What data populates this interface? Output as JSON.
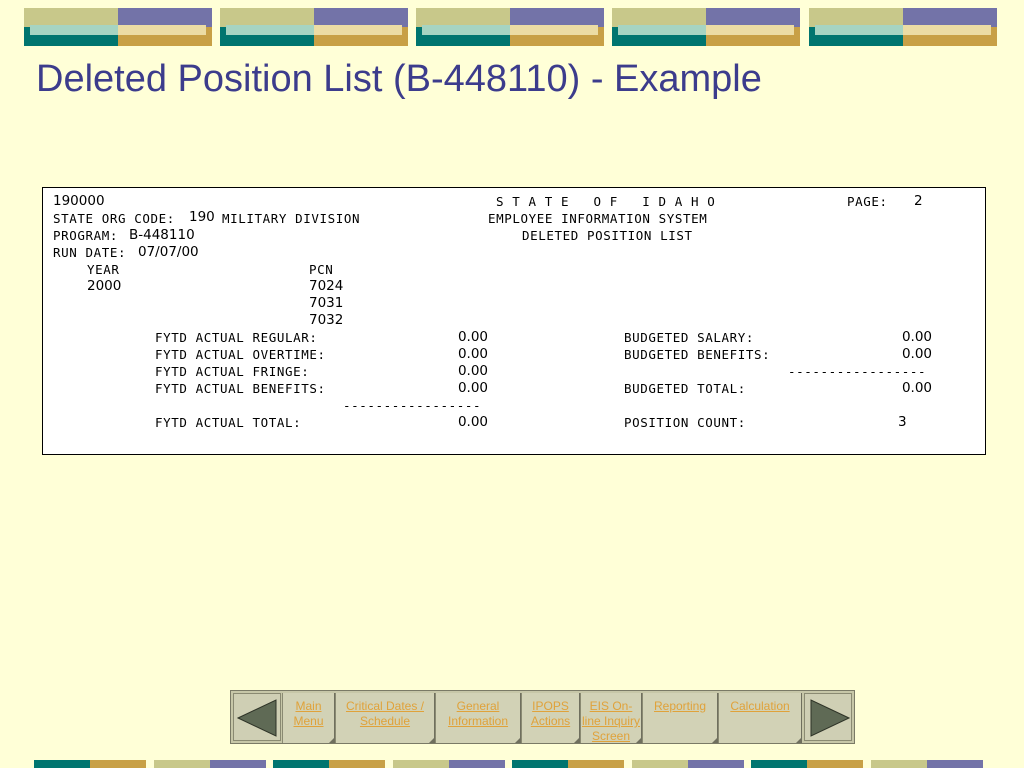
{
  "page": {
    "title": "Deleted Position List (B-448110) - Example"
  },
  "colors": {
    "background": "#ffffd7",
    "title": "#3c3c8c",
    "link": "#e0a23a",
    "band_olive": "#c8c88a",
    "band_purple": "#7373a8",
    "band_teal": "#00756f",
    "band_gold": "#c8a046"
  },
  "report": {
    "agency_code": "190000",
    "state_header": "S T A T E   O F   I D A H O",
    "page_label": "PAGE:",
    "page_number": "2",
    "org_label": "STATE ORG CODE:",
    "org_code": "190",
    "org_name": "MILITARY DIVISION",
    "system_name": "EMPLOYEE INFORMATION SYSTEM",
    "program_label": "PROGRAM:",
    "program_code": "B-448110",
    "report_name": "DELETED POSITION LIST",
    "run_date_label": "RUN DATE:",
    "run_date": "07/07/00",
    "year_header": "YEAR",
    "pcn_header": "PCN",
    "year": "2000",
    "pcns": [
      "7024",
      "7031",
      "7032"
    ],
    "actuals": [
      {
        "label": "FYTD ACTUAL REGULAR:",
        "value": "0.00"
      },
      {
        "label": "FYTD ACTUAL OVERTIME:",
        "value": "0.00"
      },
      {
        "label": "FYTD ACTUAL FRINGE:",
        "value": "0.00"
      },
      {
        "label": "FYTD ACTUAL BENEFITS:",
        "value": "0.00"
      }
    ],
    "actual_total_label": "FYTD ACTUAL TOTAL:",
    "actual_total": "0.00",
    "separator": "-----------------",
    "budgeted": [
      {
        "label": "BUDGETED SALARY:",
        "value": "0.00"
      },
      {
        "label": "BUDGETED BENEFITS:",
        "value": "0.00"
      }
    ],
    "budgeted_total_label": "BUDGETED TOTAL:",
    "budgeted_total": "0.00",
    "position_count_label": "POSITION COUNT:",
    "position_count": "3"
  },
  "nav": {
    "prev_icon": "left-triangle-icon",
    "next_icon": "right-triangle-icon",
    "links": [
      {
        "label": "Main Menu"
      },
      {
        "label": "Critical Dates / Schedule"
      },
      {
        "label": "General Information"
      },
      {
        "label": "IPOPS Actions"
      },
      {
        "label": "EIS On-line Inquiry Screen"
      },
      {
        "label": "Reporting"
      },
      {
        "label": "Calculation"
      }
    ]
  }
}
